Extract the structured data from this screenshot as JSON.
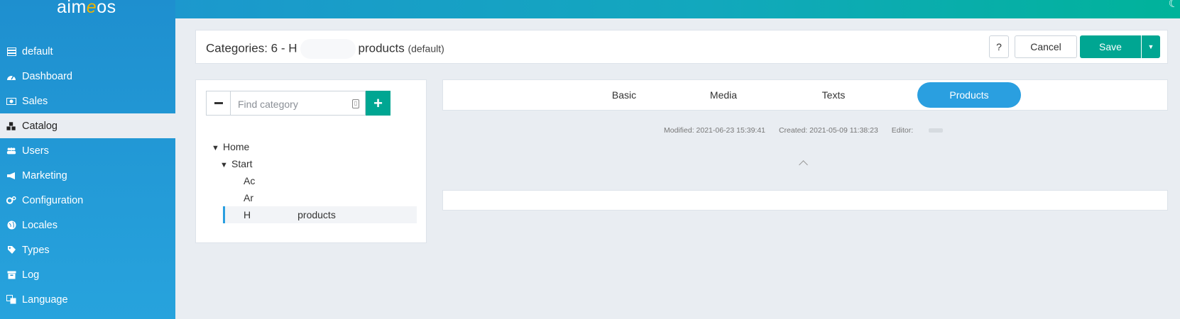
{
  "app": {
    "logo_text_1": "aim",
    "logo_text_2": "e",
    "logo_text_3": "os"
  },
  "sidebar": {
    "items": [
      {
        "label": "default",
        "icon": "server-icon"
      },
      {
        "label": "Dashboard",
        "icon": "gauge-icon"
      },
      {
        "label": "Sales",
        "icon": "money-icon"
      },
      {
        "label": "Catalog",
        "icon": "cubes-icon",
        "active": true
      },
      {
        "label": "Users",
        "icon": "users-icon"
      },
      {
        "label": "Marketing",
        "icon": "megaphone-icon"
      },
      {
        "label": "Configuration",
        "icon": "gears-icon"
      },
      {
        "label": "Locales",
        "icon": "globe-icon"
      },
      {
        "label": "Types",
        "icon": "tags-icon"
      },
      {
        "label": "Log",
        "icon": "archive-icon"
      },
      {
        "label": "Language",
        "icon": "language-icon"
      }
    ]
  },
  "header": {
    "title_prefix": "Categories: 6 - H",
    "title_suffix": "products",
    "site": "(default)",
    "help_label": "?",
    "cancel_label": "Cancel",
    "save_label": "Save"
  },
  "tree": {
    "search_placeholder": "Find category",
    "nodes": [
      {
        "label": "Home",
        "expanded": true,
        "level": 0
      },
      {
        "label": "Start",
        "expanded": true,
        "level": 1
      },
      {
        "label": "Ac",
        "level": 2
      },
      {
        "label": "Ar",
        "level": 2
      },
      {
        "label_start": "H",
        "label_end": "products",
        "level": 2,
        "selected": true
      }
    ]
  },
  "tabs": [
    {
      "label": "Basic"
    },
    {
      "label": "Media"
    },
    {
      "label": "Texts"
    },
    {
      "label": "Products",
      "active": true
    }
  ],
  "meta": {
    "modified": "Modified: 2021-06-23 15:39:41",
    "created": "Created: 2021-05-09 11:38:23",
    "editor": "Editor:"
  },
  "colors": {
    "accent": "#2a9fe0",
    "primary_button": "#00a692",
    "sidebar": "#1e8fcf"
  }
}
